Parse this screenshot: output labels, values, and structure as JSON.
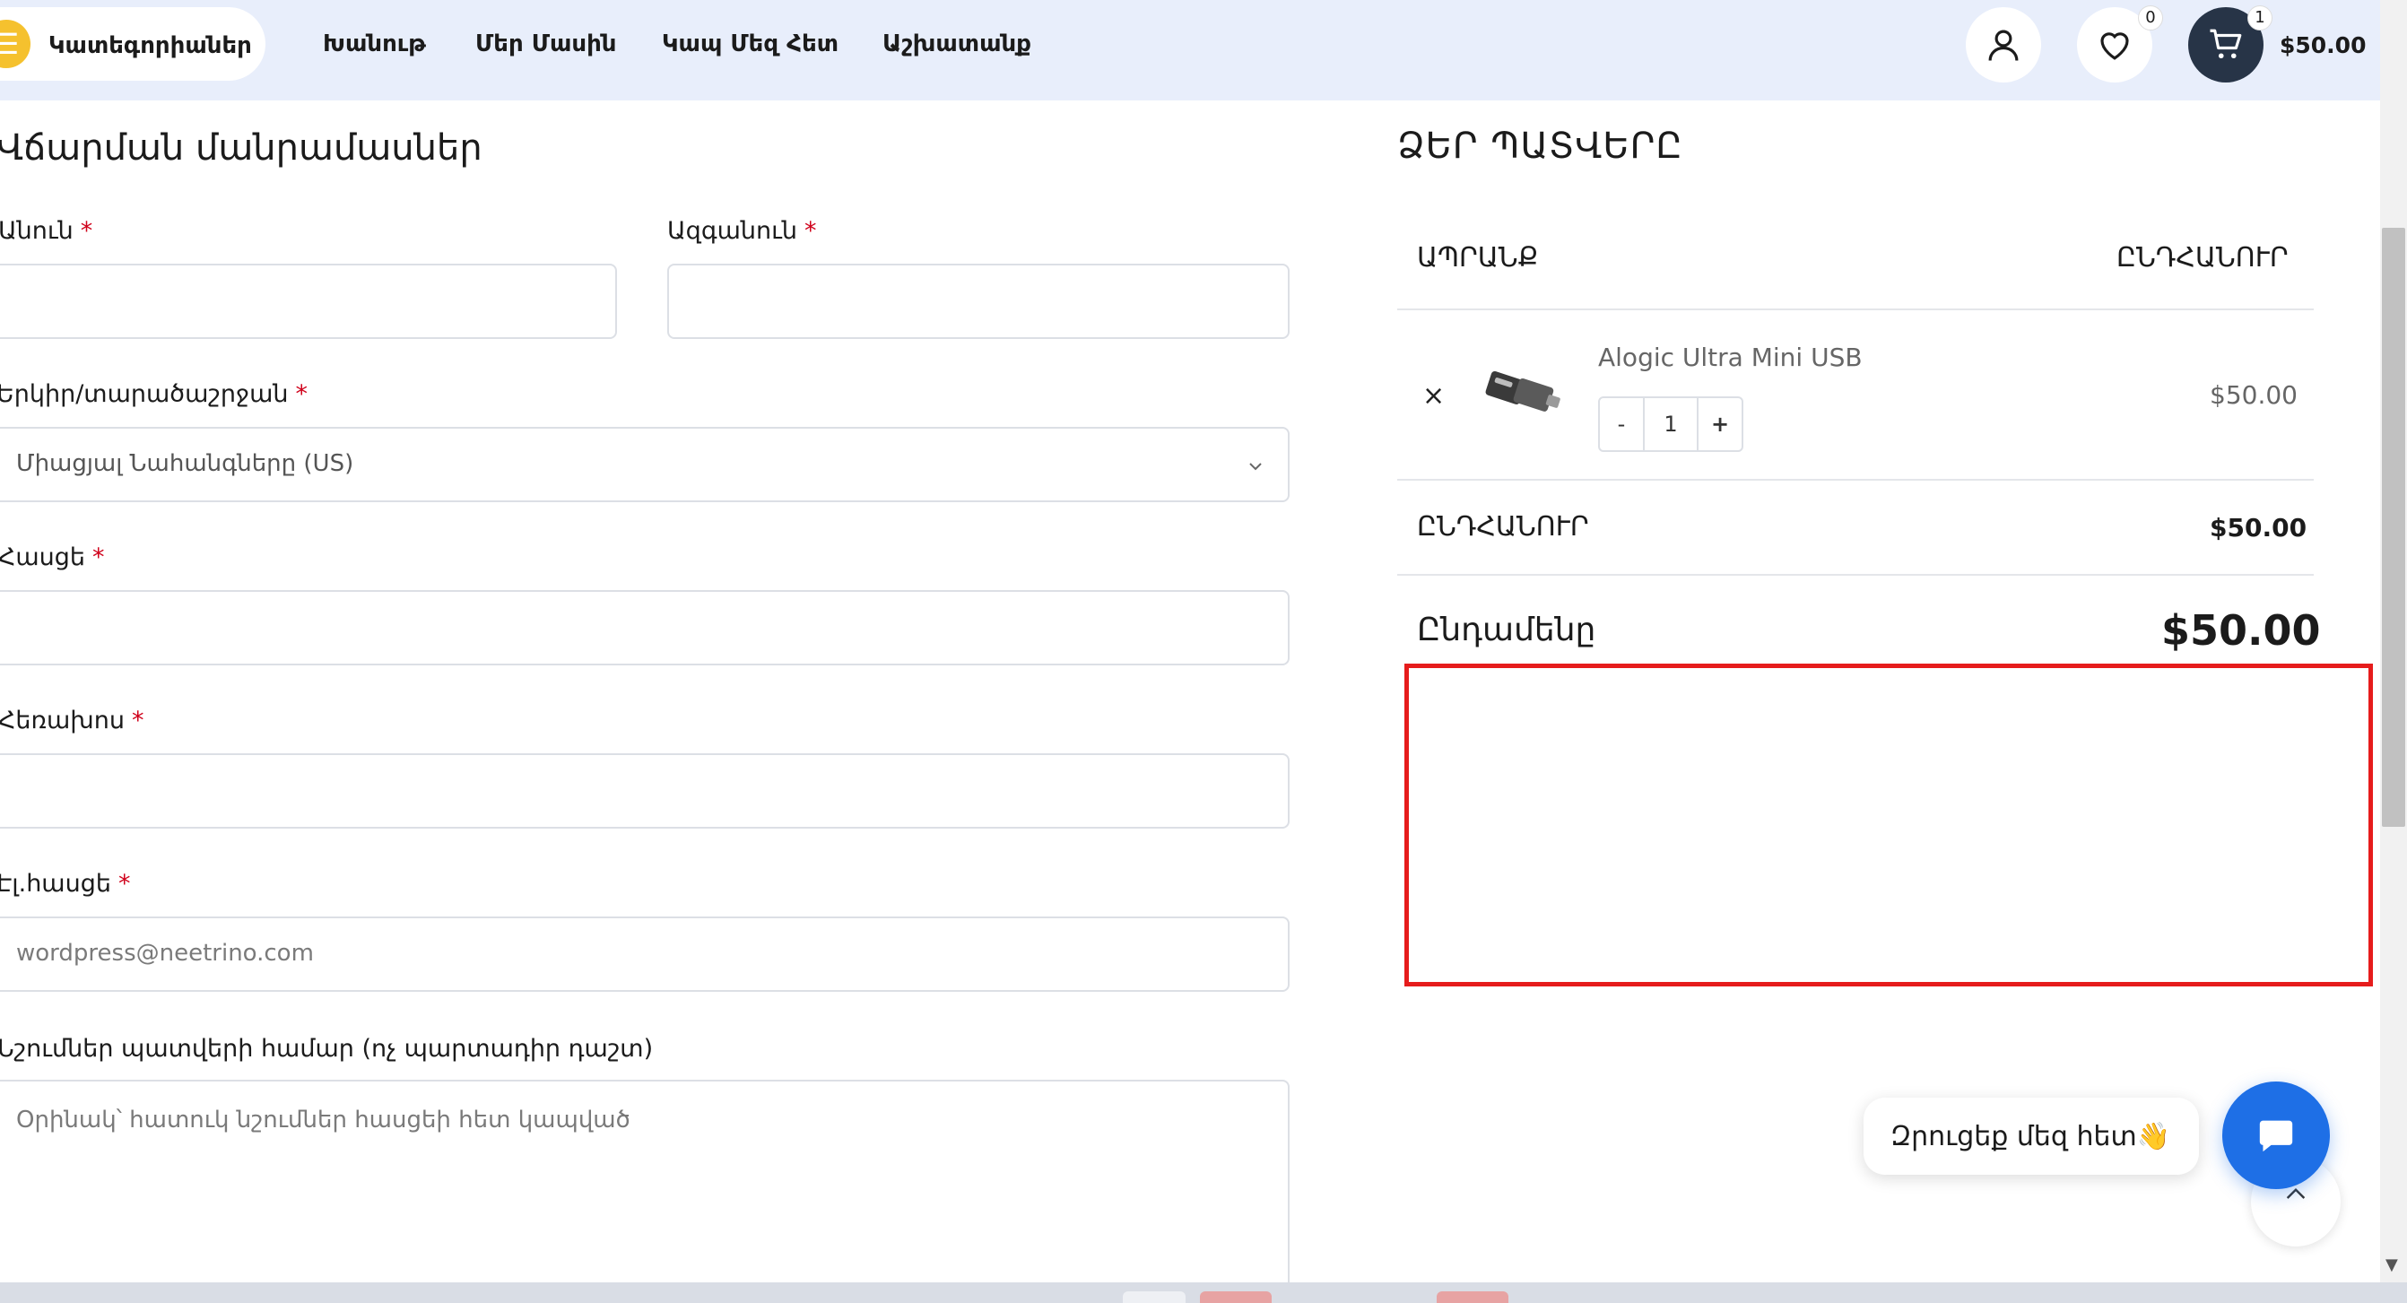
{
  "header": {
    "categories_label": "Կատեգորիաներ",
    "nav": [
      "Խանութ",
      "Մեր Մասին",
      "Կապ Մեզ Հետ",
      "Աշխատանք"
    ],
    "wishlist_count": "0",
    "cart_count": "1",
    "cart_total": "$50.00",
    "icons": [
      "menu-icon",
      "user-icon",
      "heart-icon",
      "cart-icon"
    ]
  },
  "billing": {
    "title": "Վճարման մանրամասներ",
    "first_name_label": "Անուն",
    "last_name_label": "Ազգանուն",
    "country_label": "Երկիր/տարածաշրջան",
    "country_value": "Միացյալ Նահանգները (US)",
    "address_label": "Հասցե",
    "phone_label": "Հեռախոս",
    "email_label": "Էլ.հասցե",
    "email_placeholder": "wordpress@neetrino.com",
    "notes_label": "Նշումներ պատվերի համար (ոչ պարտադիր դաշտ)",
    "notes_placeholder": "Օրինակ՝ հատուկ նշումներ հասցեի հետ կապված",
    "required_mark": "*"
  },
  "order": {
    "title": "ՁԵՐ ՊԱՏՎԵՐԸ",
    "col_product": "ԱՊՐԱՆՔ",
    "col_total": "ԸՆԴՀԱՆՈՒՐ",
    "item": {
      "remove": "×",
      "name": "Alogic Ultra Mini USB",
      "qty_minus": "-",
      "qty": "1",
      "qty_plus": "+",
      "price": "$50.00"
    },
    "subtotal_label": "ԸՆԴՀԱՆՈՒՐ",
    "subtotal_value": "$50.00",
    "total_label": "Ընդամենը",
    "total_value": "$50.00"
  },
  "chat": {
    "prompt": "Զրուցեք մեզ հետ👋"
  },
  "colors": {
    "header_bg": "#e8eefb",
    "accent_yellow": "#f5c12e",
    "cart_dark": "#273447",
    "required_red": "#d0021b",
    "highlight_red": "#e61c1c",
    "chat_blue": "#1e6fe6"
  }
}
